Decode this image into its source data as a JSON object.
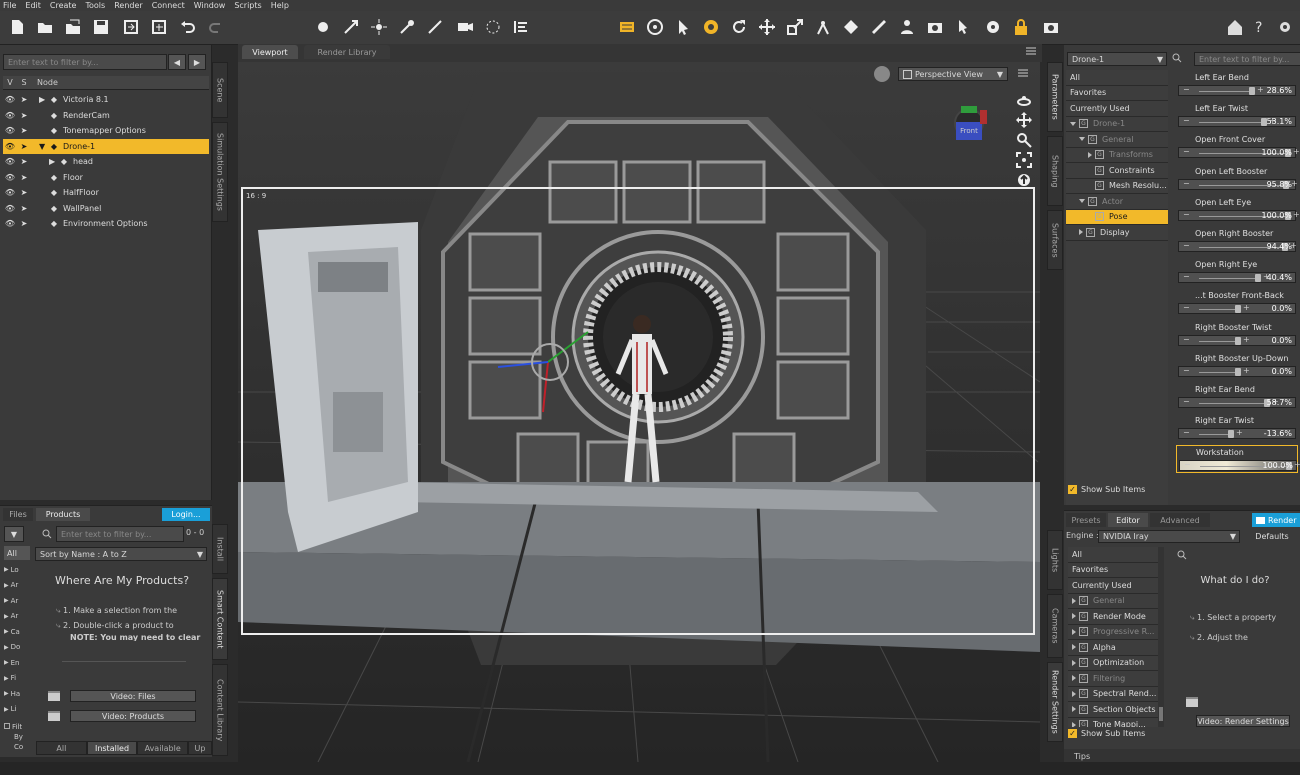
{
  "menu": [
    "File",
    "Edit",
    "Create",
    "Tools",
    "Render",
    "Connect",
    "Window",
    "Scripts",
    "Help"
  ],
  "colors": {
    "accent": "#f2b92a",
    "panel": "#3a3a3a",
    "viewport": "#2e2e2e",
    "login": "#1a9fd8"
  },
  "scene": {
    "filter_placeholder": "Enter text to filter by...",
    "col_v": "V",
    "col_s": "S",
    "col_node": "Node",
    "nodes": [
      {
        "label": "Victoria 8.1",
        "icon": "figure-icon",
        "expand": "collapsed",
        "indent": 0
      },
      {
        "label": "RenderCam",
        "icon": "camera-icon",
        "expand": "none",
        "indent": 0
      },
      {
        "label": "Tonemapper Options",
        "icon": "tonemapper-icon",
        "expand": "none",
        "indent": 0
      },
      {
        "label": "Drone-1",
        "icon": "figure-icon",
        "expand": "expanded",
        "indent": 0,
        "selected": true
      },
      {
        "label": "head",
        "icon": "prop-icon",
        "expand": "collapsed",
        "indent": 1
      },
      {
        "label": "Floor",
        "icon": "prop-icon",
        "expand": "none",
        "indent": 0
      },
      {
        "label": "HalfFloor",
        "icon": "prop-icon",
        "expand": "none",
        "indent": 0
      },
      {
        "label": "WallPanel",
        "icon": "prop-icon",
        "expand": "none",
        "indent": 0
      },
      {
        "label": "Environment Options",
        "icon": "environment-icon",
        "expand": "none",
        "indent": 0
      }
    ]
  },
  "left_vtabs": [
    "Scene",
    "Simulation Settings"
  ],
  "products": {
    "tab_files": "Files",
    "tab_products": "Products",
    "login": "Login...",
    "filter_placeholder": "Enter text to filter by...",
    "count": "0 - 0",
    "sort": "Sort by Name : A to Z",
    "cat_all": "All",
    "cats": [
      "Lo",
      "Ar",
      "Ar",
      "Ar",
      "Ca",
      "Do",
      "En",
      "Fi",
      "Ha",
      "Li"
    ],
    "heading": "Where Are My Products?",
    "step1": "1. Make a selection from the",
    "step2": "2. Double-click a product to",
    "note": "NOTE: You may need to clear",
    "video_files": "Video: Files",
    "video_products": "Video: Products",
    "filter_by_1": "Filt",
    "filter_by_2": "By",
    "filter_by_3": "Co",
    "bottom_tabs": [
      "All",
      "Installed",
      "Available",
      "Up"
    ]
  },
  "left_vtabs2": [
    "Install",
    "Smart Content",
    "Content Library"
  ],
  "viewport": {
    "tab_viewport": "Viewport",
    "tab_render_library": "Render Library",
    "view_select": "Perspective View",
    "aspect": "16 : 9",
    "cube_label": "Front"
  },
  "params_vtabs": [
    "Parameters",
    "Shaping",
    "Surfaces"
  ],
  "params": {
    "node_select": "Drone-1",
    "filter_placeholder": "Enter text to filter by...",
    "tree": [
      {
        "label": "All",
        "indent": 0,
        "type": "plain"
      },
      {
        "label": "Favorites",
        "indent": 0,
        "type": "plain"
      },
      {
        "label": "Currently Used",
        "indent": 0,
        "type": "plain"
      },
      {
        "label": "Drone-1",
        "indent": 0,
        "type": "group",
        "expand": "expanded",
        "dim": true
      },
      {
        "label": "General",
        "indent": 1,
        "type": "group",
        "expand": "expanded",
        "dim": true
      },
      {
        "label": "Transforms",
        "indent": 2,
        "type": "group",
        "expand": "collapsed",
        "dim": true
      },
      {
        "label": "Constraints",
        "indent": 2,
        "type": "group",
        "expand": "none"
      },
      {
        "label": "Mesh Resolu...",
        "indent": 2,
        "type": "group",
        "expand": "none"
      },
      {
        "label": "Actor",
        "indent": 1,
        "type": "group",
        "expand": "expanded",
        "dim": true
      },
      {
        "label": "Pose",
        "indent": 2,
        "type": "group",
        "expand": "none",
        "selected": true
      },
      {
        "label": "Display",
        "indent": 1,
        "type": "group",
        "expand": "collapsed"
      }
    ],
    "show_sub_items": "Show Sub Items",
    "sliders": [
      {
        "label": "Left Ear Bend",
        "value": "28.6%",
        "pos": 0.64
      },
      {
        "label": "Left Ear Twist",
        "value": "53.1%",
        "pos": 0.76
      },
      {
        "label": "Open Front Cover",
        "value": "100.0%",
        "pos": 1.0
      },
      {
        "label": "Open Left Booster",
        "value": "95.8%",
        "pos": 0.98
      },
      {
        "label": "Open Left Eye",
        "value": "100.0%",
        "pos": 1.0
      },
      {
        "label": "Open Right Booster",
        "value": "94.4%",
        "pos": 0.97
      },
      {
        "label": "Open Right Eye",
        "value": "40.4%",
        "pos": 0.7
      },
      {
        "label": "...t Booster Front-Back",
        "value": "0.0%",
        "pos": 0.5
      },
      {
        "label": "Right Booster Twist",
        "value": "0.0%",
        "pos": 0.5
      },
      {
        "label": "Right Booster Up-Down",
        "value": "0.0%",
        "pos": 0.5
      },
      {
        "label": "Right Ear Bend",
        "value": "58.7%",
        "pos": 0.79
      },
      {
        "label": "Right Ear Twist",
        "value": "-13.6%",
        "pos": 0.43
      },
      {
        "label": "Workstation",
        "value": "100.0%",
        "pos": 1.0,
        "highlight": true
      }
    ]
  },
  "render": {
    "tabs": [
      "Presets",
      "Editor",
      "Advanced"
    ],
    "render_btn": "Render",
    "engine_label": "Engine :",
    "engine_value": "NVIDIA Iray",
    "defaults": "Defaults",
    "tree": [
      {
        "label": "All",
        "type": "plain"
      },
      {
        "label": "Favorites",
        "type": "plain"
      },
      {
        "label": "Currently Used",
        "type": "plain"
      },
      {
        "label": "General",
        "type": "group",
        "dim": true
      },
      {
        "label": "Render Mode",
        "type": "group"
      },
      {
        "label": "Progressive R...",
        "type": "group",
        "dim": true
      },
      {
        "label": "Alpha",
        "type": "group"
      },
      {
        "label": "Optimization",
        "type": "group"
      },
      {
        "label": "Filtering",
        "type": "group",
        "dim": true
      },
      {
        "label": "Spectral Rend...",
        "type": "group"
      },
      {
        "label": "Section Objects",
        "type": "group"
      },
      {
        "label": "Tone Mappi...",
        "type": "group"
      }
    ],
    "show_sub_items": "Show Sub Items",
    "help_title": "What do I do?",
    "help_1": "1. Select a property",
    "help_2": "2. Adjust the",
    "video": "Video: Render Settings",
    "tips": "Tips"
  },
  "render_vtabs": [
    "Lights",
    "Cameras",
    "Render Settings"
  ]
}
